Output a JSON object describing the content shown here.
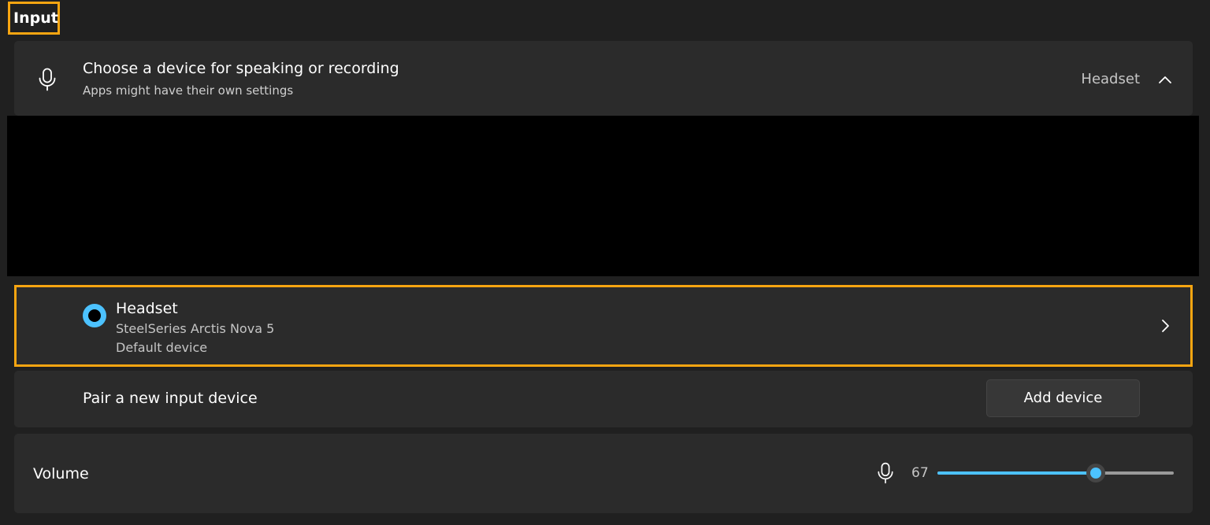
{
  "section": {
    "title": "Input"
  },
  "input_device": {
    "title": "Choose a device for speaking or recording",
    "subtitle": "Apps might have their own settings",
    "selected_value": "Headset"
  },
  "device": {
    "name": "Headset",
    "model": "SteelSeries Arctis Nova 5",
    "status": "Default device"
  },
  "pair": {
    "label": "Pair a new input device",
    "button_label": "Add device"
  },
  "volume": {
    "label": "Volume",
    "value": "67",
    "level": 0.67
  },
  "colors": {
    "accent": "#4cc2ff",
    "highlight_border": "#f7a511",
    "background": "#202020",
    "card": "#2b2b2b"
  },
  "icons": {
    "mic": "microphone-icon",
    "chevron_up": "chevron-up-icon",
    "chevron_right": "chevron-right-icon"
  }
}
